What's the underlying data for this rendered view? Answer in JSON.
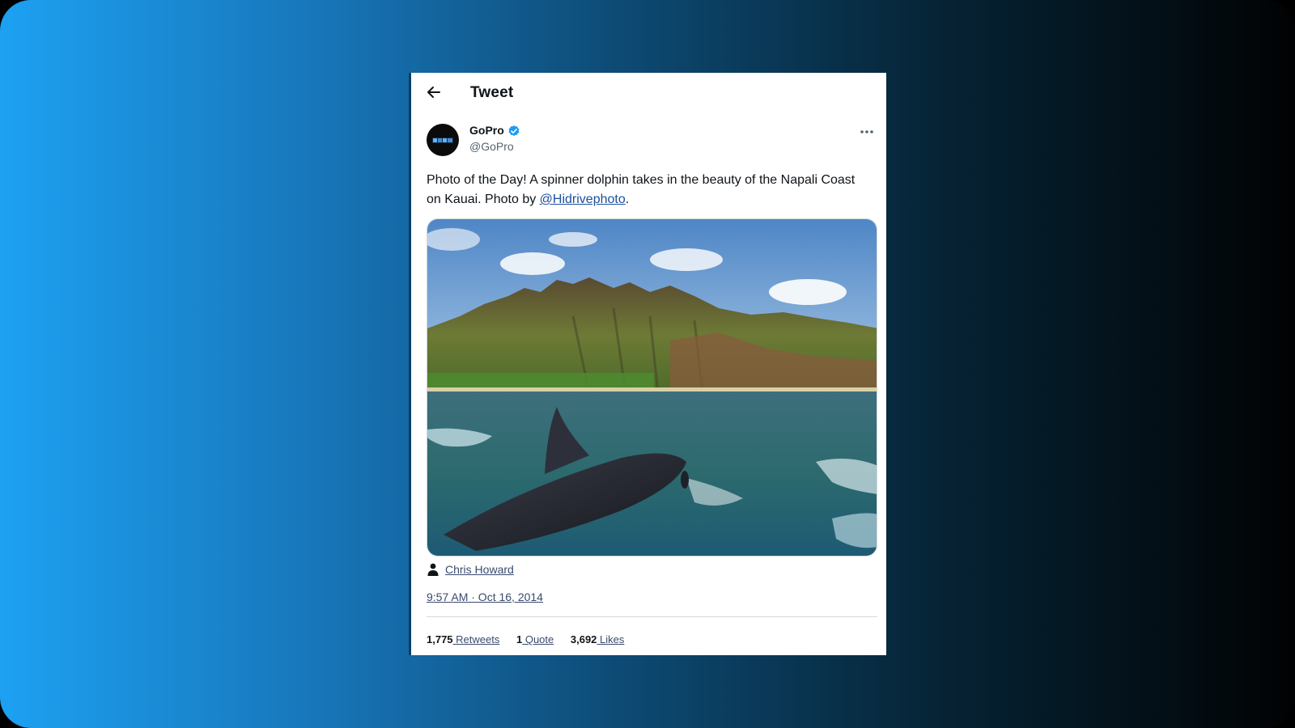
{
  "header": {
    "title": "Tweet",
    "back_icon": "arrow-left-icon"
  },
  "author": {
    "display_name": "GoPro",
    "handle": "@GoPro",
    "verified": true,
    "verified_color": "#1d9bf0",
    "avatar_bg": "#000000"
  },
  "tweet": {
    "text_before": "Photo of the Day! A spinner dolphin takes in the beauty of the Napali Coast on Kauai. Photo by ",
    "mention": "@Hidrivephoto",
    "text_after": "."
  },
  "media": {
    "tagged_user_icon": "person-icon",
    "tagged_user": "Chris Howard"
  },
  "timestamp": "9:57 AM · Oct 16, 2014",
  "stats": {
    "retweets": {
      "count": "1,775",
      "label": " Retweets"
    },
    "quotes": {
      "count": "1",
      "label": " Quote"
    },
    "likes": {
      "count": "3,692",
      "label": " Likes"
    }
  },
  "colors": {
    "background_gradient": [
      "#1da1f2",
      "#000000"
    ],
    "link": "#1b4f9c",
    "text": "#0f1419"
  }
}
